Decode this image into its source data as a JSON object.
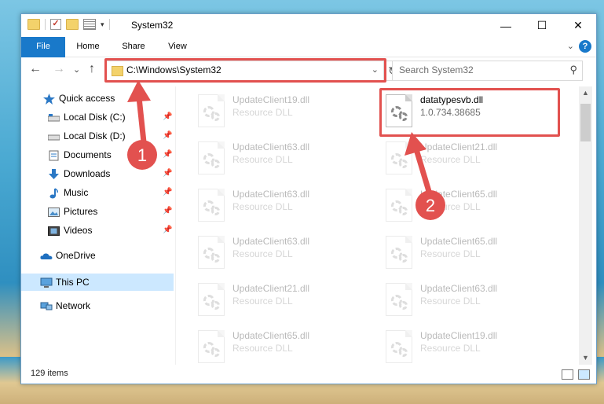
{
  "window": {
    "title": "System32",
    "minimize": "—",
    "maximize": "☐",
    "close": "✕"
  },
  "ribbon": {
    "tabs": [
      "File",
      "Home",
      "Share",
      "View"
    ],
    "help": "?",
    "expand": "⌄"
  },
  "navigation": {
    "back": "←",
    "forward": "→",
    "recent": "⌄",
    "up": "↑"
  },
  "address": {
    "path": "C:\\Windows\\System32",
    "dropdown": "⌄",
    "refresh": "↻"
  },
  "search": {
    "placeholder": "Search System32",
    "icon": "⚲"
  },
  "sidebar": {
    "items": [
      {
        "label": "Quick access",
        "icon": "star-icon",
        "pinned": false
      },
      {
        "label": "Local Disk (C:)",
        "icon": "drive-icon",
        "pinned": true
      },
      {
        "label": "Local Disk (D:)",
        "icon": "drive-icon",
        "pinned": true
      },
      {
        "label": "Documents",
        "icon": "documents-icon",
        "pinned": true
      },
      {
        "label": "Downloads",
        "icon": "download-icon",
        "pinned": true
      },
      {
        "label": "Music",
        "icon": "music-icon",
        "pinned": true
      },
      {
        "label": "Pictures",
        "icon": "pictures-icon",
        "pinned": true
      },
      {
        "label": "Videos",
        "icon": "videos-icon",
        "pinned": true
      },
      {
        "label": "OneDrive",
        "icon": "cloud-icon",
        "pinned": false
      },
      {
        "label": "This PC",
        "icon": "computer-icon",
        "pinned": false,
        "selected": true
      },
      {
        "label": "Network",
        "icon": "network-icon",
        "pinned": false
      }
    ],
    "pin_glyph": "📌"
  },
  "files": [
    {
      "name": "UpdateClient19.dll",
      "type": "Resource DLL",
      "highlighted": false
    },
    {
      "name": "datatypesvb.dll",
      "type": "1.0.734.38685",
      "highlighted": true
    },
    {
      "name": "UpdateClient63.dll",
      "type": "Resource DLL",
      "highlighted": false
    },
    {
      "name": "UpdateClient21.dll",
      "type": "Resource DLL",
      "highlighted": false
    },
    {
      "name": "UpdateClient63.dll",
      "type": "Resource DLL",
      "highlighted": false
    },
    {
      "name": "UpdateClient65.dll",
      "type": "Resource DLL",
      "highlighted": false
    },
    {
      "name": "UpdateClient63.dll",
      "type": "Resource DLL",
      "highlighted": false
    },
    {
      "name": "UpdateClient65.dll",
      "type": "Resource DLL",
      "highlighted": false
    },
    {
      "name": "UpdateClient21.dll",
      "type": "Resource DLL",
      "highlighted": false
    },
    {
      "name": "UpdateClient63.dll",
      "type": "Resource DLL",
      "highlighted": false
    },
    {
      "name": "UpdateClient65.dll",
      "type": "Resource DLL",
      "highlighted": false
    },
    {
      "name": "UpdateClient19.dll",
      "type": "Resource DLL",
      "highlighted": false
    }
  ],
  "status": {
    "item_count": "129 items"
  },
  "annotations": {
    "step1": "1",
    "step2": "2",
    "color": "#e2514f"
  },
  "colors": {
    "accent": "#1979ca",
    "selection": "#cce8ff",
    "annotation_red": "#e2514f"
  }
}
